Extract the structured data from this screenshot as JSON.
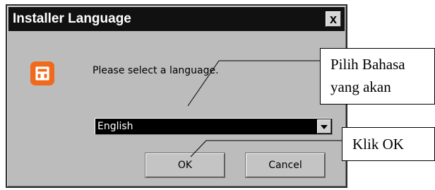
{
  "window": {
    "title": "Installer Language",
    "close_label": "x"
  },
  "dialog": {
    "prompt": "Please select a language.",
    "icon": "xampp-logo-icon",
    "language_select": {
      "selected": "English",
      "dropdown_icon": "triangle-down-icon"
    },
    "buttons": {
      "ok": "OK",
      "cancel": "Cancel"
    }
  },
  "annotations": {
    "select_language_callout": [
      "Pilih Bahasa",
      "yang akan"
    ],
    "ok_callout": "Klik OK"
  },
  "colors": {
    "titlebar": "#111111",
    "dialog_bg": "#bcbcbc",
    "icon_bg": "#f06a1d",
    "select_bg": "#000000"
  }
}
